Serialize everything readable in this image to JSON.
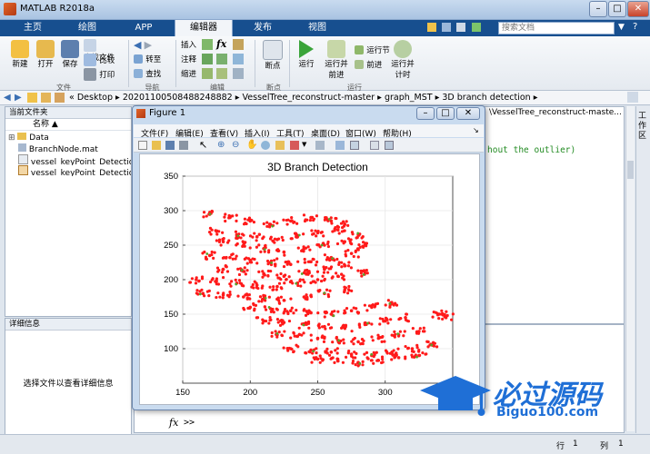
{
  "window": {
    "title": "MATLAB R2018a",
    "search_placeholder": "搜索文档"
  },
  "tabs": [
    {
      "label": "主页"
    },
    {
      "label": "绘图"
    },
    {
      "label": "APP"
    },
    {
      "label": "编辑器",
      "active": true
    },
    {
      "label": "发布"
    },
    {
      "label": "视图"
    }
  ],
  "ribbon": {
    "file": {
      "new": "新建",
      "open": "打开",
      "save": "保存",
      "find_files": "查找文件",
      "compare": "比较",
      "print": "打印",
      "group": "文件"
    },
    "navigate": {
      "goto": "转至",
      "find": "查找",
      "group": "导航"
    },
    "edit": {
      "insert": "插入",
      "comment": "注释",
      "indent": "缩进",
      "fx": "fx",
      "group": "编辑"
    },
    "breakpoints": {
      "label": "断点",
      "group": "断点"
    },
    "run": {
      "run": "运行",
      "run_advance_1": "运行并",
      "run_advance_2": "前进",
      "run_section": "运行节",
      "advance": "前进",
      "run_time_1": "运行并",
      "run_time_2": "计时",
      "group": "运行"
    }
  },
  "address": {
    "crumbs": [
      "Desktop",
      "20201100508488248882",
      "VesselTree_reconstruct-master",
      "graph_MST",
      "3D branch detection"
    ],
    "right_title": "\\VesselTree_reconstruct-maste..."
  },
  "current_folder": {
    "title": "当前文件夹",
    "column_name": "名称",
    "items": [
      {
        "name": "Data",
        "type": "folder"
      },
      {
        "name": "BranchNode.mat",
        "type": "mat"
      },
      {
        "name": "vessel_keyPoint_Detection.asv",
        "type": "asv"
      },
      {
        "name": "vessel_keyPoint_Detection.m",
        "type": "m"
      }
    ]
  },
  "details": {
    "title": "详细信息",
    "empty_text": "选择文件以查看详细信息"
  },
  "editor": {
    "code_fragment": "hout the outlier)"
  },
  "command": {
    "fx": "fx",
    "prompt": ">>"
  },
  "status": {
    "line_label": "行",
    "line_value": "1",
    "col_label": "列",
    "col_value": "1"
  },
  "side_label": "工作区",
  "figure": {
    "title": "Figure 1",
    "menu": [
      "文件(F)",
      "编辑(E)",
      "查看(V)",
      "插入(I)",
      "工具(T)",
      "桌面(D)",
      "窗口(W)",
      "帮助(H)"
    ]
  },
  "watermark": {
    "brand": "必过源码",
    "url": "Biguo100.com"
  },
  "colors": {
    "title_bg": "#a9c3e2",
    "tab_bg": "#174f8f",
    "scatter_red": "#ff1a1a",
    "scatter_green": "#5aa02c"
  },
  "chart_data": {
    "type": "scatter",
    "title": "3D Branch Detection",
    "xlabel": "",
    "ylabel": "",
    "xlim": [
      150,
      350
    ],
    "ylim": [
      50,
      350
    ],
    "xticks": [
      150,
      200,
      250,
      300
    ],
    "yticks": [
      100,
      150,
      200,
      250,
      300,
      350
    ],
    "grid": true,
    "series": [
      {
        "color": "#ff1a1a",
        "marker": "dot",
        "description_points": [
          [
            170,
            295
          ],
          [
            185,
            290
          ],
          [
            200,
            285
          ],
          [
            215,
            280
          ],
          [
            230,
            285
          ],
          [
            245,
            290
          ],
          [
            260,
            285
          ],
          [
            270,
            280
          ],
          [
            175,
            270
          ],
          [
            190,
            265
          ],
          [
            205,
            262
          ],
          [
            220,
            258
          ],
          [
            235,
            262
          ],
          [
            250,
            268
          ],
          [
            265,
            272
          ],
          [
            280,
            265
          ],
          [
            180,
            255
          ],
          [
            195,
            250
          ],
          [
            210,
            245
          ],
          [
            225,
            240
          ],
          [
            240,
            245
          ],
          [
            255,
            250
          ],
          [
            270,
            255
          ],
          [
            285,
            250
          ],
          [
            170,
            235
          ],
          [
            185,
            232
          ],
          [
            200,
            228
          ],
          [
            215,
            225
          ],
          [
            230,
            222
          ],
          [
            245,
            226
          ],
          [
            260,
            232
          ],
          [
            275,
            238
          ],
          [
            180,
            215
          ],
          [
            195,
            212
          ],
          [
            210,
            208
          ],
          [
            225,
            205
          ],
          [
            240,
            210
          ],
          [
            255,
            215
          ],
          [
            270,
            220
          ],
          [
            285,
            210
          ],
          [
            160,
            200
          ],
          [
            175,
            198
          ],
          [
            190,
            195
          ],
          [
            205,
            192
          ],
          [
            220,
            190
          ],
          [
            235,
            195
          ],
          [
            250,
            200
          ],
          [
            265,
            205
          ],
          [
            165,
            180
          ],
          [
            180,
            178
          ],
          [
            195,
            175
          ],
          [
            210,
            172
          ],
          [
            225,
            170
          ],
          [
            240,
            175
          ],
          [
            255,
            180
          ],
          [
            270,
            185
          ],
          [
            200,
            160
          ],
          [
            215,
            158
          ],
          [
            230,
            155
          ],
          [
            245,
            152
          ],
          [
            260,
            150
          ],
          [
            275,
            155
          ],
          [
            290,
            160
          ],
          [
            305,
            165
          ],
          [
            210,
            140
          ],
          [
            225,
            138
          ],
          [
            240,
            135
          ],
          [
            255,
            132
          ],
          [
            270,
            130
          ],
          [
            285,
            135
          ],
          [
            300,
            140
          ],
          [
            315,
            145
          ],
          [
            220,
            120
          ],
          [
            235,
            118
          ],
          [
            250,
            115
          ],
          [
            265,
            112
          ],
          [
            280,
            110
          ],
          [
            295,
            115
          ],
          [
            310,
            120
          ],
          [
            325,
            125
          ],
          [
            230,
            100
          ],
          [
            245,
            98
          ],
          [
            260,
            95
          ],
          [
            275,
            92
          ],
          [
            290,
            90
          ],
          [
            305,
            95
          ],
          [
            320,
            100
          ],
          [
            335,
            105
          ],
          [
            250,
            85
          ],
          [
            265,
            82
          ],
          [
            280,
            80
          ],
          [
            295,
            83
          ],
          [
            310,
            87
          ],
          [
            325,
            90
          ],
          [
            340,
            150
          ],
          [
            345,
            145
          ]
        ]
      }
    ]
  }
}
